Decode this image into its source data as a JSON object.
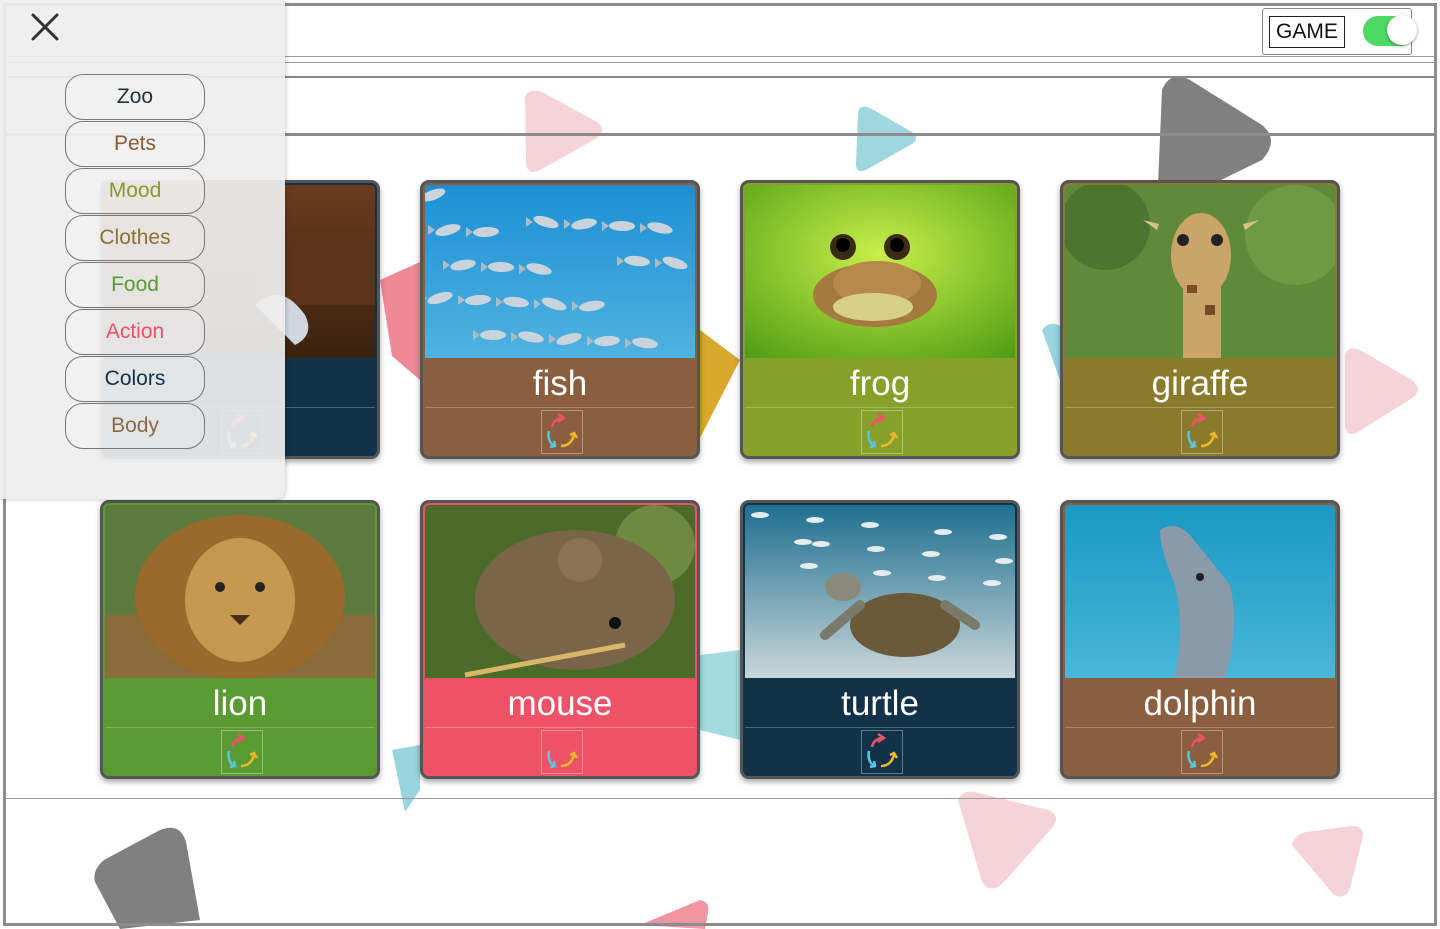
{
  "header": {
    "game_label": "GAME",
    "game_toggle_on": true
  },
  "menu": {
    "items": [
      {
        "label": "Zoo",
        "color": "#1f3340"
      },
      {
        "label": "Pets",
        "color": "#8a5a35"
      },
      {
        "label": "Mood",
        "color": "#8a9a2a"
      },
      {
        "label": "Clothes",
        "color": "#8a7233"
      },
      {
        "label": "Food",
        "color": "#5a9a32"
      },
      {
        "label": "Action",
        "color": "#ef5266"
      },
      {
        "label": "Colors",
        "color": "#143247"
      },
      {
        "label": "Body",
        "color": "#8a6a45"
      }
    ]
  },
  "cards": [
    {
      "label": "",
      "color": "#12324a",
      "photo": "hidden-animal"
    },
    {
      "label": "fish",
      "color": "#8a5e3e",
      "photo": "fish"
    },
    {
      "label": "frog",
      "color": "#87a02a",
      "photo": "frog"
    },
    {
      "label": "giraffe",
      "color": "#8a7a2c",
      "photo": "giraffe"
    },
    {
      "label": "lion",
      "color": "#5a9a32",
      "photo": "lion"
    },
    {
      "label": "mouse",
      "color": "#ef5266",
      "photo": "mouse"
    },
    {
      "label": "turtle",
      "color": "#12324a",
      "photo": "turtle"
    },
    {
      "label": "dolphin",
      "color": "#8a5e3e",
      "photo": "dolphin"
    }
  ],
  "colors": {
    "toggle_on": "#4cd964",
    "pink_shape": "#f4c7d0",
    "teal_shape": "#7fcad4",
    "gray_shape": "#808080",
    "red_shape": "#ee7b8b",
    "gold_shape": "#d8a92c"
  }
}
